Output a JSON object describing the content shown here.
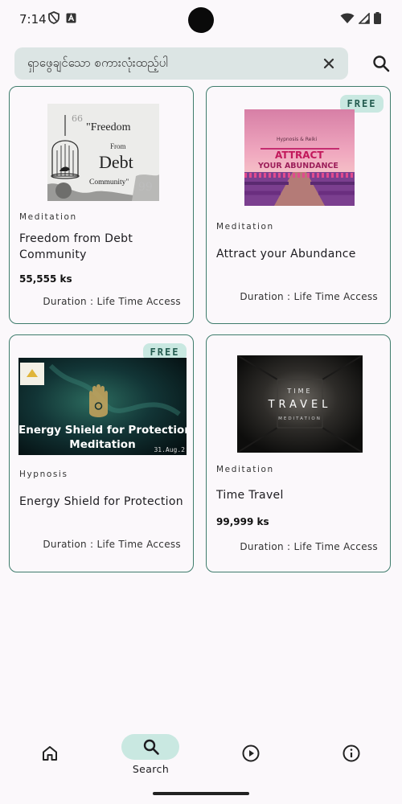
{
  "status_bar": {
    "time": "7:14",
    "left_icons": [
      "shield-icon",
      "app-notification-icon"
    ],
    "right_icons": [
      "wifi-icon",
      "cell-signal-icon",
      "battery-icon"
    ]
  },
  "search": {
    "value": "ရှာဖွေချင်သော စကားလုံးထည့်ပါ",
    "clear_icon": "close-icon",
    "search_icon": "search-icon"
  },
  "courses": [
    {
      "badge": "",
      "thumbnail": {
        "quote_text": "\"Freedom",
        "from_text": "From",
        "debt_text": "Debt",
        "community_text": "Community\"",
        "icon": "birdcage-image"
      },
      "category": "Meditation",
      "title": "Freedom from Debt Community",
      "price": "55,555 ks",
      "duration": "Duration : Life Time Access"
    },
    {
      "badge": "FREE",
      "thumbnail": {
        "top_text": "Hypnosis & Reiki",
        "main_text": "ATTRACT",
        "sub_text": "YOUR ABUNDANCE",
        "icon": "lavender-field-image"
      },
      "category": "Meditation",
      "title": "Attract your Abundance",
      "price": "",
      "duration": "Duration : Life Time Access"
    },
    {
      "badge": "FREE",
      "thumbnail": {
        "line1": "Energy Shield for Protection",
        "line2": "Meditation",
        "date_text": "31.Aug.2",
        "icon": "hamsa-hand-image"
      },
      "category": "Hypnosis",
      "title": "Energy Shield for Protection",
      "price": "",
      "duration": "Duration : Life Time Access"
    },
    {
      "badge": "",
      "thumbnail": {
        "line1": "TIME",
        "line2": "TRAVEL",
        "line3": "MEDITATION",
        "icon": "dark-tunnel-image"
      },
      "category": "Meditation",
      "title": "Time Travel",
      "price": "99,999 ks",
      "duration": "Duration : Life Time Access"
    }
  ],
  "bottom_nav": {
    "items": [
      {
        "icon": "home-icon",
        "label": "",
        "active": false
      },
      {
        "icon": "search-icon",
        "label": "Search",
        "active": true
      },
      {
        "icon": "play-circle-icon",
        "label": "",
        "active": false
      },
      {
        "icon": "info-icon",
        "label": "",
        "active": false
      }
    ]
  },
  "colors": {
    "accent": "#3e7c6c",
    "badge_bg": "#c9e8e1",
    "search_bg": "#dce5e4",
    "background": "#fbf8fb"
  }
}
